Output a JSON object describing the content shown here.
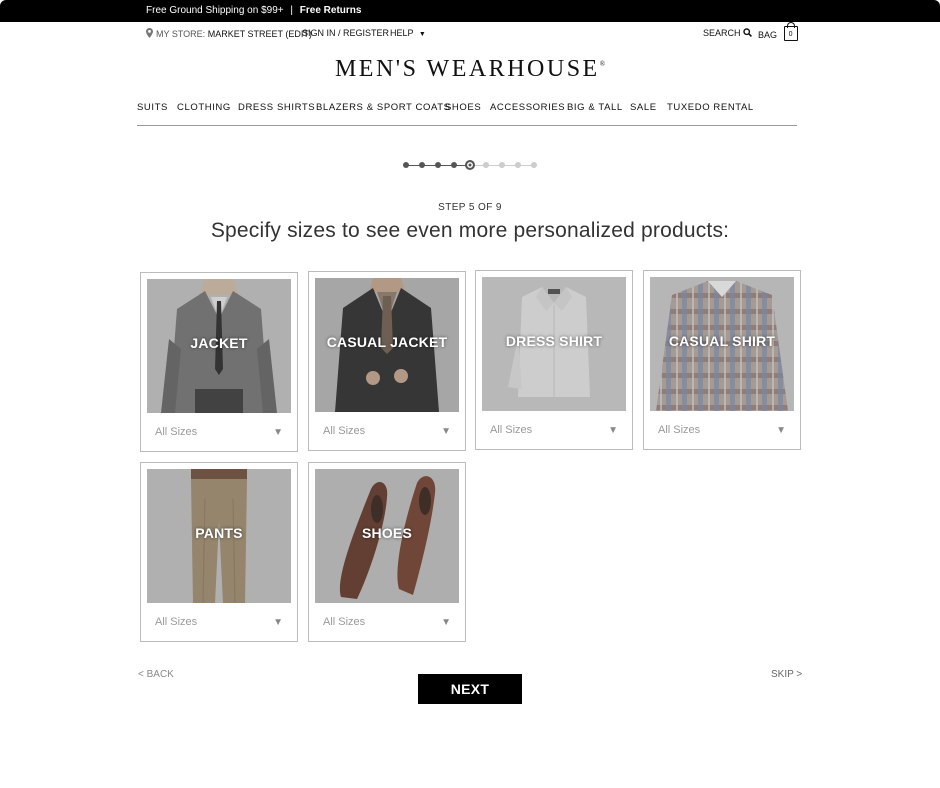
{
  "promo": {
    "shipping_text": "Free Ground Shipping on $99+",
    "separator": "|",
    "returns_text": "Free Returns"
  },
  "utility": {
    "store_prefix": "MY STORE:",
    "store_name": "MARKET STREET (EDIT)",
    "sign_in": "SIGN IN / REGISTER",
    "help": "HELP",
    "search": "SEARCH",
    "bag": "BAG",
    "bag_count": "0"
  },
  "brand": {
    "logo_text": "MEN'S WEARHOUSE",
    "registered": "®"
  },
  "nav": {
    "items": [
      "SUITS",
      "CLOTHING",
      "DRESS SHIRTS",
      "BLAZERS & SPORT COATS",
      "SHOES",
      "ACCESSORIES",
      "BIG & TALL",
      "SALE",
      "TUXEDO RENTAL"
    ]
  },
  "progress": {
    "current_step": 5,
    "total_steps": 9,
    "step_label": "STEP 5 OF 9"
  },
  "headline": "Specify sizes to see even more personalized products:",
  "categories": [
    {
      "label": "JACKET",
      "size_value": "All Sizes",
      "icon": "jacket-photo"
    },
    {
      "label": "CASUAL JACKET",
      "size_value": "All Sizes",
      "icon": "casual-jacket-photo"
    },
    {
      "label": "DRESS SHIRT",
      "size_value": "All Sizes",
      "icon": "dress-shirt-photo"
    },
    {
      "label": "CASUAL SHIRT",
      "size_value": "All Sizes",
      "icon": "casual-shirt-photo"
    },
    {
      "label": "PANTS",
      "size_value": "All Sizes",
      "icon": "pants-photo"
    },
    {
      "label": "SHOES",
      "size_value": "All Sizes",
      "icon": "shoes-photo"
    }
  ],
  "footer_nav": {
    "back": "< BACK",
    "next": "NEXT",
    "skip": "SKIP >"
  },
  "colors": {
    "promo_bg": "#000000",
    "next_bg": "#000000",
    "step_active": "#555555",
    "step_inactive": "#cccccc"
  }
}
